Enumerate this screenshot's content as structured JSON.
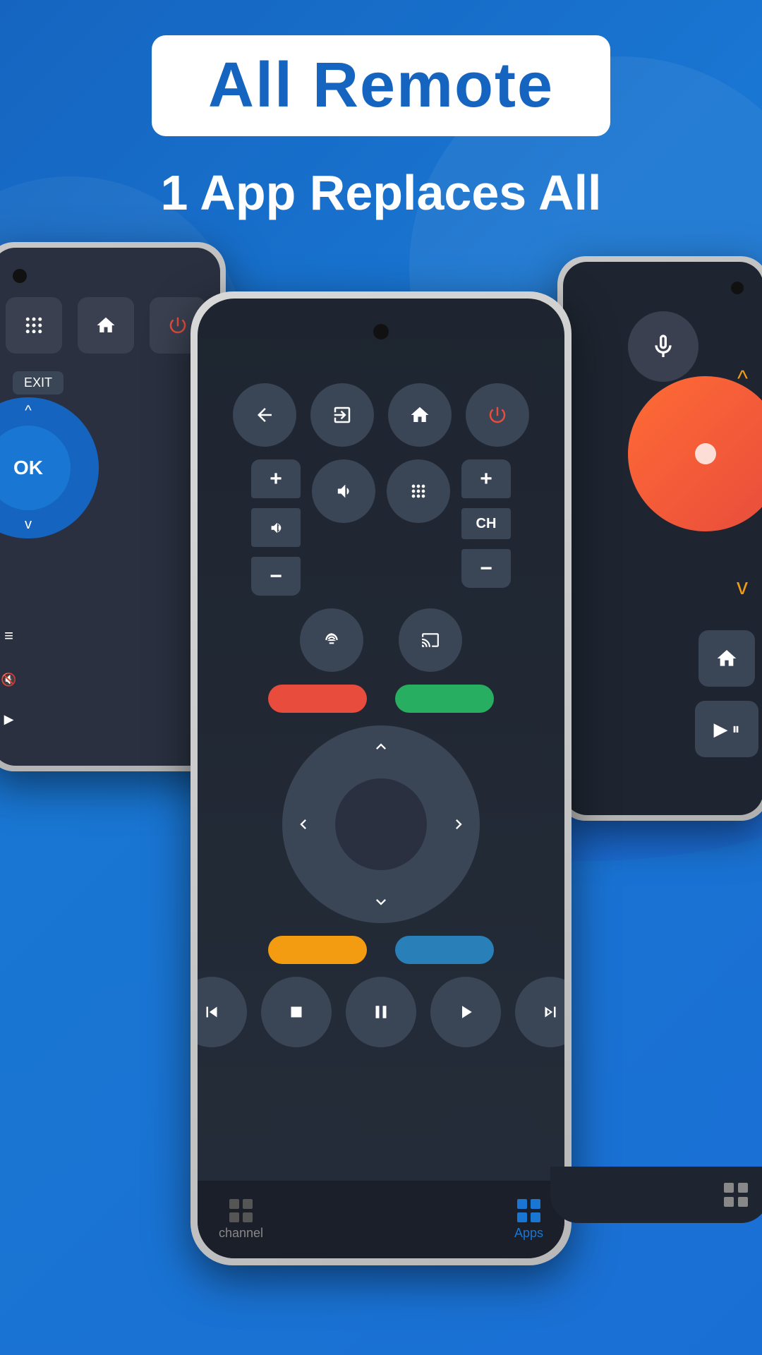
{
  "app": {
    "title": "All Remote",
    "subtitle": "1 App Replaces All"
  },
  "header": {
    "title_label": "All Remote",
    "subtitle_label": "1 App Replaces All"
  },
  "remote_center": {
    "btn_back": "‹",
    "btn_exit": "⇥",
    "btn_home": "⌂",
    "btn_power": "⏻",
    "btn_vol_plus": "+",
    "btn_vol_minus": "−",
    "btn_mute": "🔈",
    "btn_numpad": "⁙",
    "btn_ch_plus": "+",
    "btn_ch_minus": "−",
    "btn_ch_label": "CH",
    "btn_remote": "📺",
    "btn_cast": "📲",
    "color_red": "red",
    "color_green": "green",
    "color_yellow": "yellow",
    "color_blue": "blue",
    "dpad_up": "▲",
    "dpad_down": "▼",
    "dpad_left": "◀",
    "dpad_right": "▶",
    "media_rewind": "⏮",
    "media_stop": "⏹",
    "media_pause": "⏸",
    "media_play": "▶",
    "media_forward": "⏭"
  },
  "bottom_nav": {
    "channel_label": "channel",
    "apps_label": "Apps"
  },
  "exit_label": "EXIT",
  "left_phone": {
    "btn_numpad": "⊞",
    "btn_home": "⌂",
    "btn_power": "⏻"
  },
  "right_phone": {
    "btn_mic": "🎤"
  }
}
